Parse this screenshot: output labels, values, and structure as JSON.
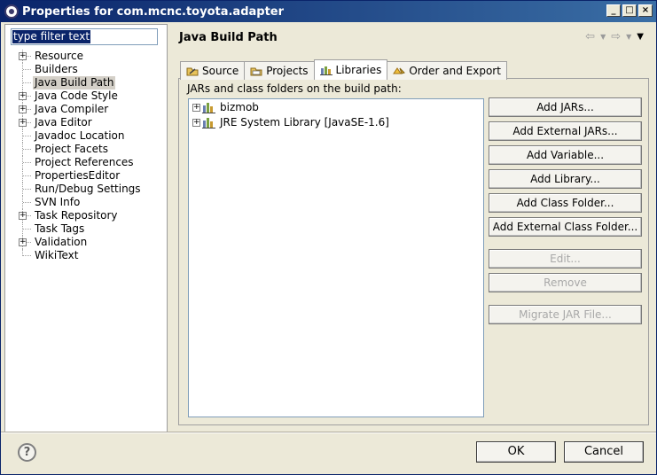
{
  "window": {
    "title": "Properties for com.mcnc.toyota.adapter"
  },
  "filter": {
    "value": "type filter text"
  },
  "tree": [
    {
      "label": "Resource",
      "expandable": true
    },
    {
      "label": "Builders",
      "expandable": false
    },
    {
      "label": "Java Build Path",
      "expandable": false,
      "selected": true
    },
    {
      "label": "Java Code Style",
      "expandable": true
    },
    {
      "label": "Java Compiler",
      "expandable": true
    },
    {
      "label": "Java Editor",
      "expandable": true
    },
    {
      "label": "Javadoc Location",
      "expandable": false
    },
    {
      "label": "Project Facets",
      "expandable": false
    },
    {
      "label": "Project References",
      "expandable": false
    },
    {
      "label": "PropertiesEditor",
      "expandable": false
    },
    {
      "label": "Run/Debug Settings",
      "expandable": false
    },
    {
      "label": "SVN Info",
      "expandable": false
    },
    {
      "label": "Task Repository",
      "expandable": true
    },
    {
      "label": "Task Tags",
      "expandable": false
    },
    {
      "label": "Validation",
      "expandable": true
    },
    {
      "label": "WikiText",
      "expandable": false
    }
  ],
  "page": {
    "title": "Java Build Path"
  },
  "tabs": [
    {
      "label": "Source",
      "icon": "source-folder-icon"
    },
    {
      "label": "Projects",
      "icon": "projects-folder-icon"
    },
    {
      "label": "Libraries",
      "icon": "libraries-icon",
      "active": true
    },
    {
      "label": "Order and Export",
      "icon": "order-export-icon"
    }
  ],
  "libraries": {
    "caption": "JARs and class folders on the build path:",
    "items": [
      {
        "label": "bizmob",
        "icon": "library-icon"
      },
      {
        "label": "JRE System Library [JavaSE-1.6]",
        "icon": "library-icon"
      }
    ]
  },
  "buttons": {
    "add_jars": "Add JARs...",
    "add_external_jars": "Add External JARs...",
    "add_variable": "Add Variable...",
    "add_library": "Add Library...",
    "add_class_folder": "Add Class Folder...",
    "add_external_class_folder": "Add External Class Folder...",
    "edit": "Edit...",
    "remove": "Remove",
    "migrate_jar": "Migrate JAR File..."
  },
  "dialog": {
    "ok": "OK",
    "cancel": "Cancel"
  },
  "nav": {
    "back_icon": "back-arrow-icon",
    "forward_icon": "forward-arrow-icon",
    "menu_icon": "view-menu-icon"
  }
}
